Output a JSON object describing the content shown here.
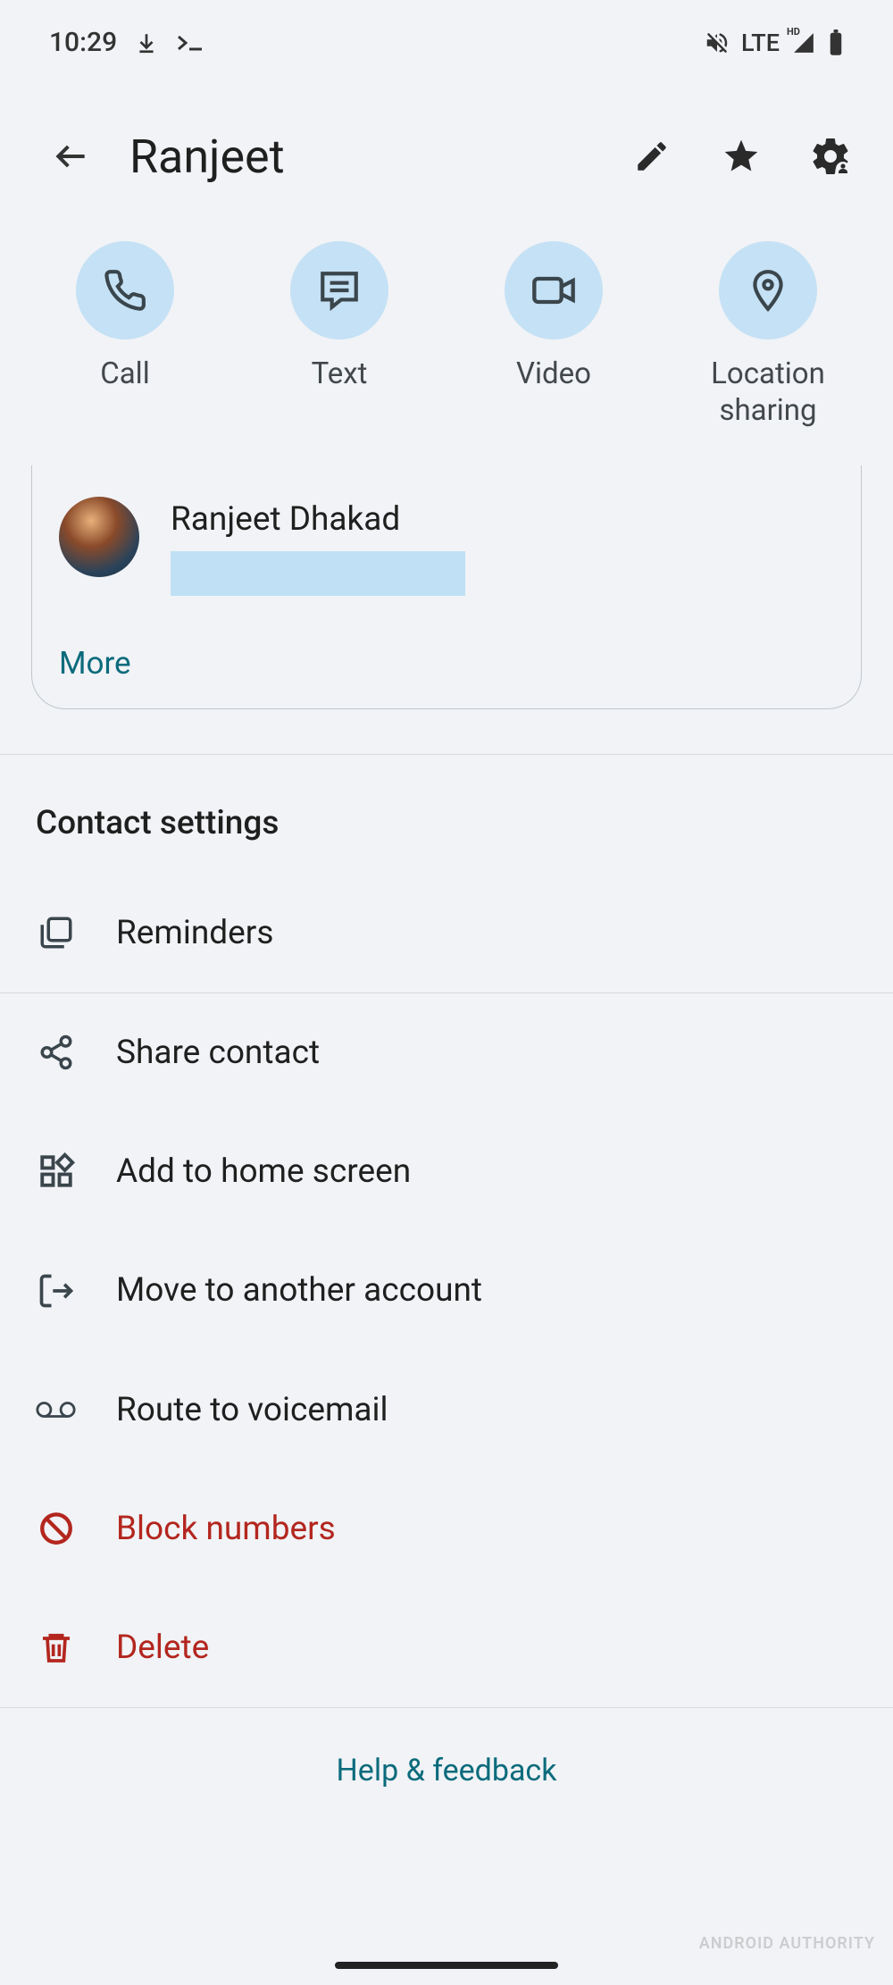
{
  "status": {
    "time": "10:29",
    "network_label": "LTE",
    "hd_label": "HD"
  },
  "appbar": {
    "title": "Ranjeet"
  },
  "actions": {
    "call": "Call",
    "text": "Text",
    "video": "Video",
    "location": "Location\nsharing"
  },
  "card": {
    "name": "Ranjeet Dhakad",
    "more": "More"
  },
  "settings": {
    "header": "Contact settings",
    "reminders": "Reminders",
    "share": "Share contact",
    "homescreen": "Add to home screen",
    "move": "Move to another account",
    "voicemail": "Route to voicemail",
    "block": "Block numbers",
    "delete": "Delete"
  },
  "footer": {
    "help": "Help & feedback",
    "watermark": "ANDROID AUTHORITY"
  }
}
